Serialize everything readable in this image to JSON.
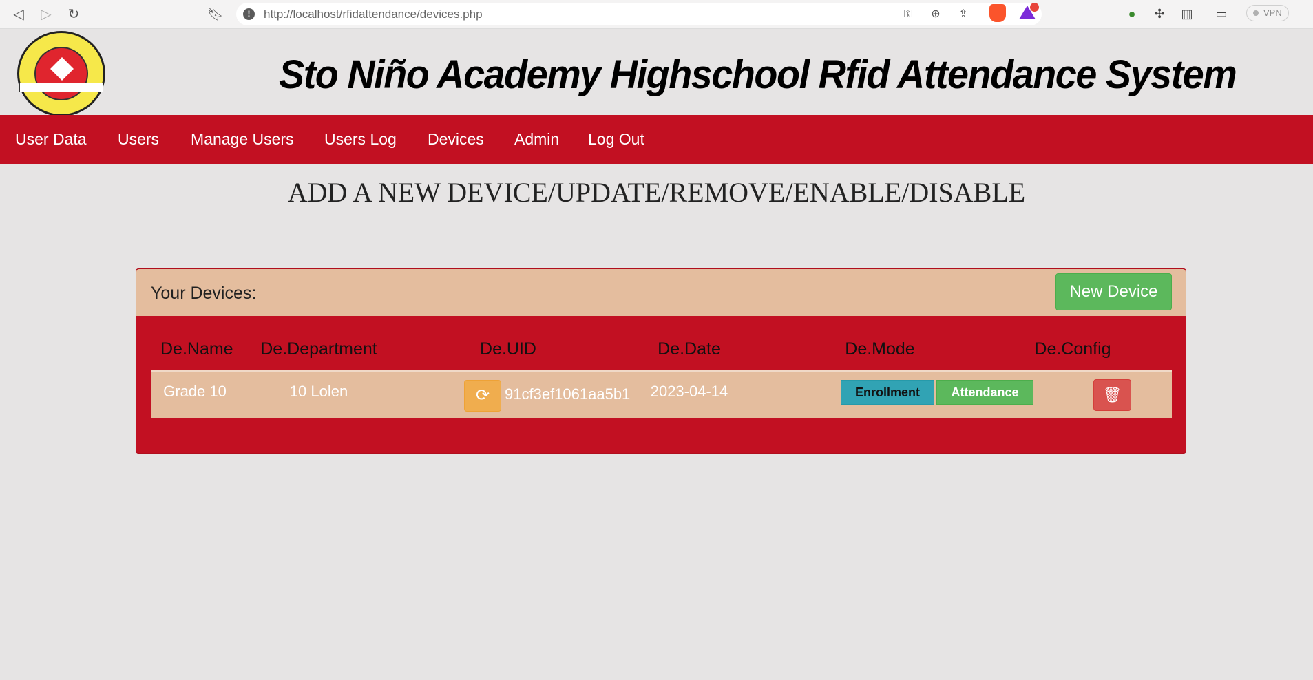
{
  "browser": {
    "url": "http://localhost/rfidattendance/devices.php",
    "vpn_label": "VPN"
  },
  "header": {
    "title": "Sto Niño Academy Highschool Rfid Attendance System"
  },
  "nav": {
    "items": [
      {
        "label": "User Data"
      },
      {
        "label": "Users"
      },
      {
        "label": "Manage Users"
      },
      {
        "label": "Users Log"
      },
      {
        "label": "Devices"
      },
      {
        "label": "Admin"
      },
      {
        "label": "Log Out"
      }
    ]
  },
  "page": {
    "heading": "ADD A NEW DEVICE/UPDATE/REMOVE/ENABLE/DISABLE"
  },
  "devices_panel": {
    "title": "Your Devices:",
    "new_device_label": "New Device",
    "columns": [
      "De.Name",
      "De.Department",
      "De.UID",
      "De.Date",
      "De.Mode",
      "De.Config"
    ],
    "rows": [
      {
        "name": "Grade 10",
        "department": "10 Lolen",
        "uid": "91cf3ef1061aa5b1",
        "date": "2023-04-14",
        "mode_enrollment_label": "Enrollment",
        "mode_attendance_label": "Attendance"
      }
    ]
  },
  "colors": {
    "nav_bg": "#c21022",
    "panel_head_bg": "#e4bd9e",
    "success": "#5cb85c",
    "warning": "#f0ad4e",
    "danger": "#d9534f",
    "info": "#31a3b4"
  }
}
